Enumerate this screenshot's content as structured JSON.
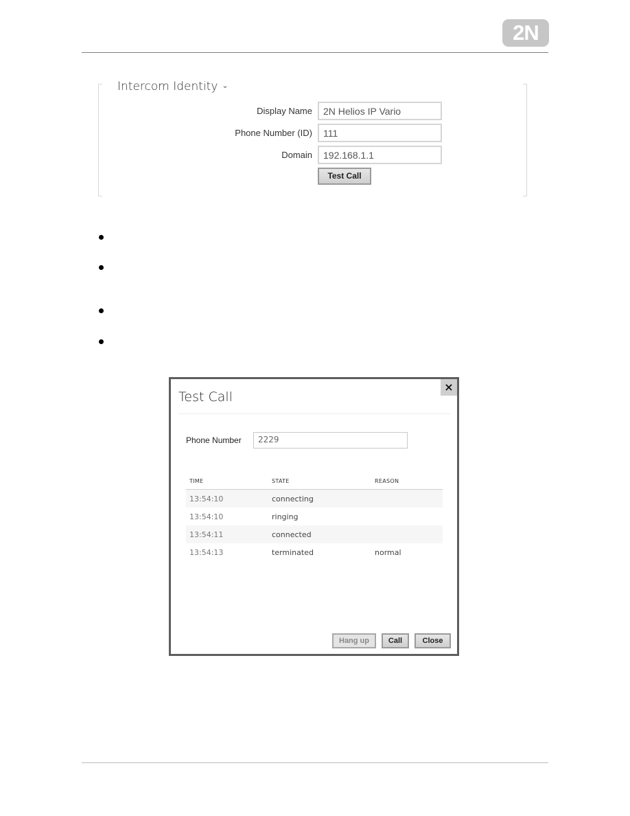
{
  "header": {
    "logo_text": "2N"
  },
  "intercom_identity": {
    "title": "Intercom Identity",
    "chevron_icon": "chevron-down-icon",
    "fields": [
      {
        "label": "Display Name",
        "value": "2N Helios IP Vario"
      },
      {
        "label": "Phone Number (ID)",
        "value": "111"
      },
      {
        "label": "Domain",
        "value": "192.168.1.1"
      }
    ],
    "test_call_button": "Test Call"
  },
  "bullets": {
    "count": 4
  },
  "test_call_dialog": {
    "title": "Test Call",
    "close_icon": "×",
    "phone_label": "Phone Number",
    "phone_value": "2229",
    "columns": [
      "TIME",
      "STATE",
      "REASON"
    ],
    "rows": [
      {
        "time": "13:54:10",
        "state": "connecting",
        "reason": ""
      },
      {
        "time": "13:54:10",
        "state": "ringing",
        "reason": ""
      },
      {
        "time": "13:54:11",
        "state": "connected",
        "reason": ""
      },
      {
        "time": "13:54:13",
        "state": "terminated",
        "reason": "normal"
      }
    ],
    "buttons": {
      "hang_up": "Hang up",
      "call": "Call",
      "close": "Close"
    }
  }
}
